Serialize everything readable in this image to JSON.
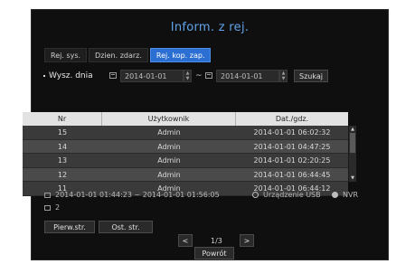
{
  "window": {
    "title": "Inform. z rej."
  },
  "tabs": [
    {
      "label": "Rej. sys.",
      "active": false
    },
    {
      "label": "Dzien. zdarz.",
      "active": false
    },
    {
      "label": "Rej. kop. zap.",
      "active": true
    }
  ],
  "search": {
    "label": "Wysz. dnia",
    "from_date": "2014-01-01",
    "separator": "~",
    "to_date": "2014-01-01",
    "button_label": "Szukaj"
  },
  "table": {
    "headers": [
      "Nr",
      "Użytkownik",
      "Dat./gdz."
    ],
    "rows": [
      {
        "nr": "15",
        "user": "Admin",
        "datetime": "2014-01-01 06:02:32"
      },
      {
        "nr": "14",
        "user": "Admin",
        "datetime": "2014-01-01 04:47:25"
      },
      {
        "nr": "13",
        "user": "Admin",
        "datetime": "2014-01-01 02:20:25"
      },
      {
        "nr": "12",
        "user": "Admin",
        "datetime": "2014-01-01 06:44:45"
      },
      {
        "nr": "11",
        "user": "Admin",
        "datetime": "2014-01-01 06:44:12"
      }
    ]
  },
  "details": {
    "range": "2014-01-01 01:44:23 ~ 2014-01-01 01:56:05",
    "count": "2",
    "device_label": "Urządzenie USB",
    "format_label": "NVR"
  },
  "pagination": {
    "first_label": "Pierw.str.",
    "last_label": "Ost. str.",
    "prev_icon": "<",
    "next_icon": ">",
    "page_text": "1/3"
  },
  "footer": {
    "back_label": "Powrót"
  },
  "colors": {
    "accent": "#2b6fd2",
    "title": "#5fa3e8",
    "background": "#0f0f0f"
  }
}
